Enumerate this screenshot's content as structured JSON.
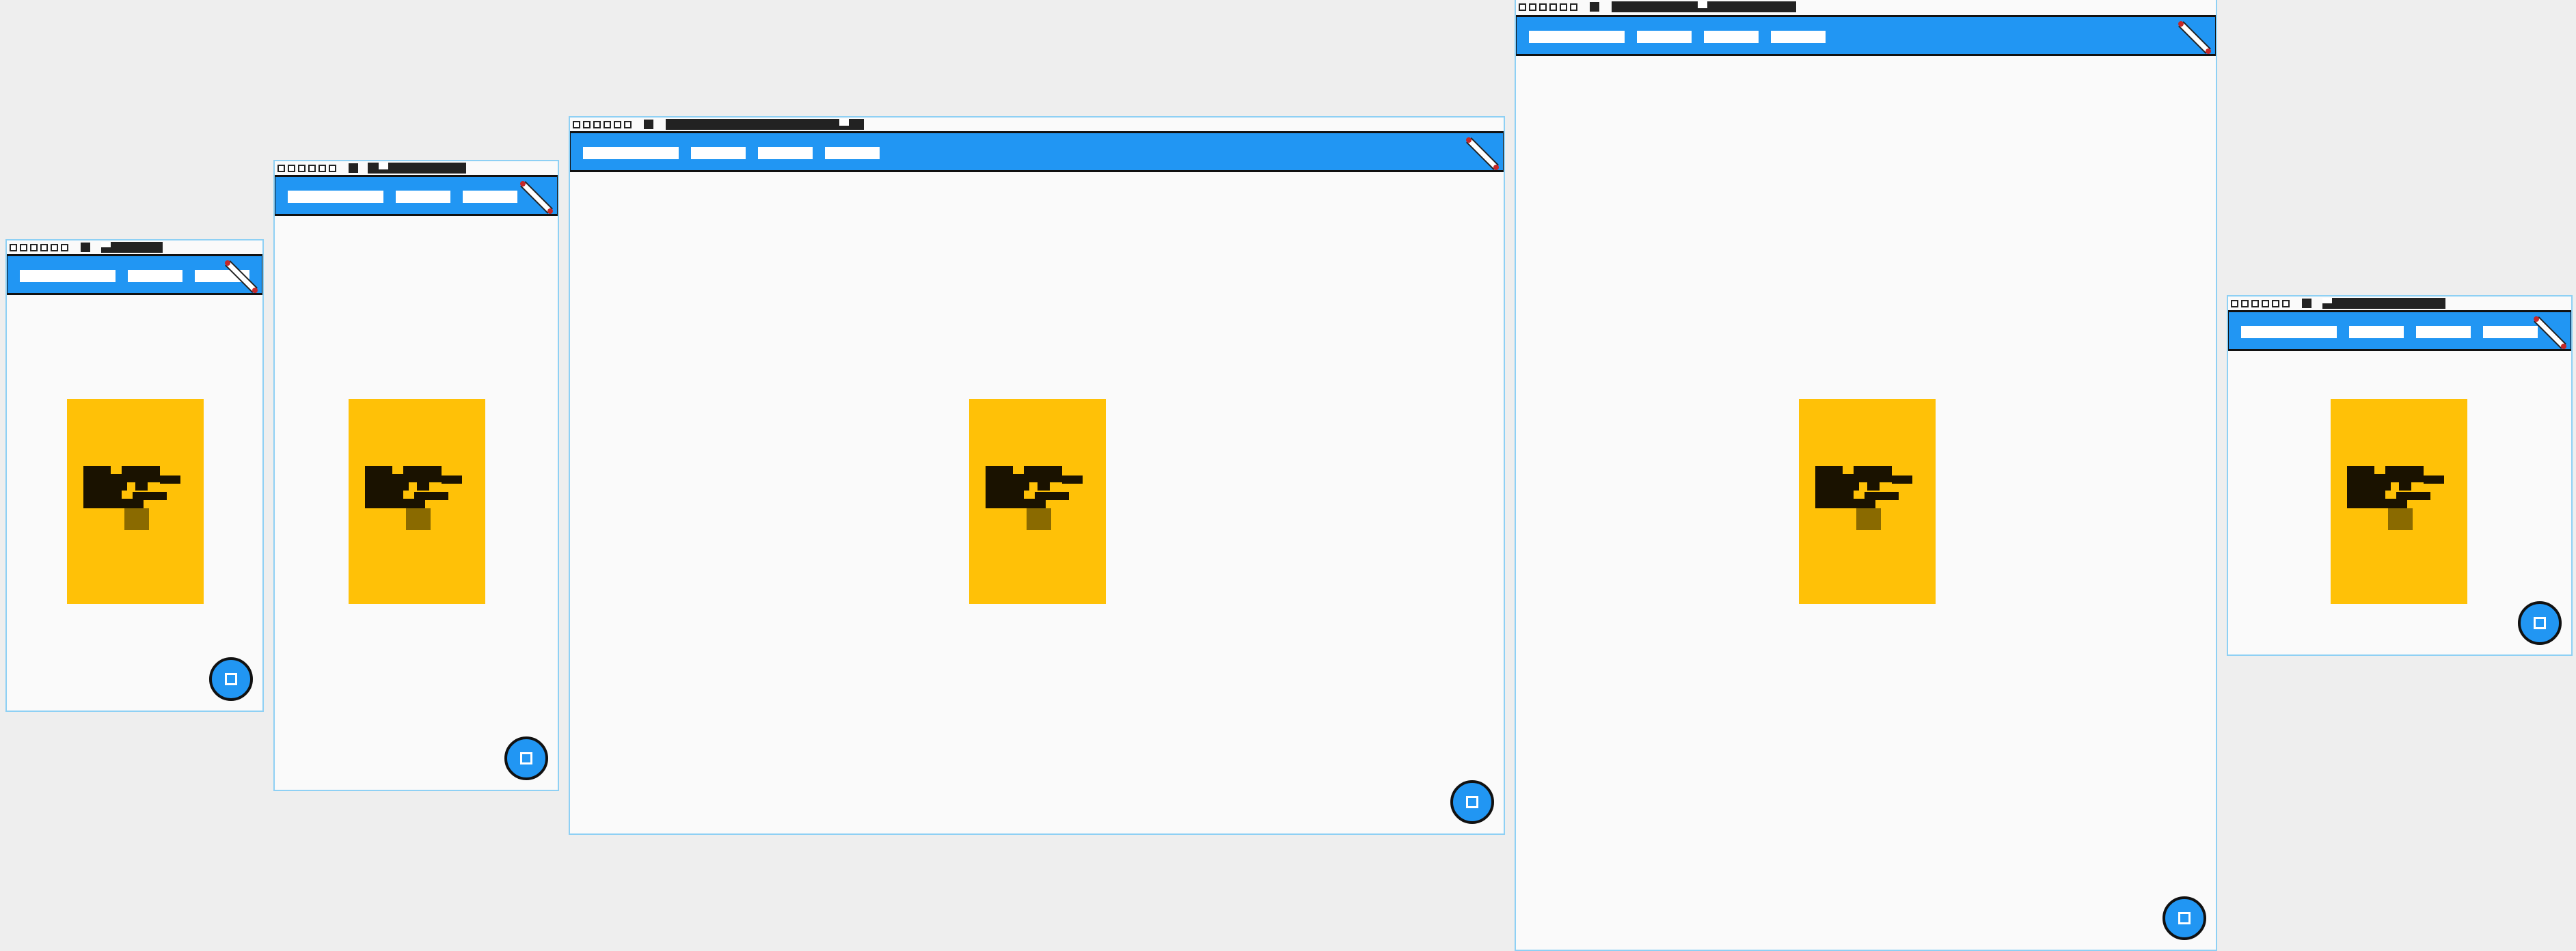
{
  "colors": {
    "background": "#eeeeee",
    "screen": "#fafafa",
    "screen_border": "#8ed0f4",
    "app_bar": "#2196f3",
    "card": "#ffc107",
    "card_figure": "#1a1200",
    "card_figure_base": "#8a6a00",
    "fab": "#2196f3"
  },
  "icons": {
    "app_bar_action": "pencil-icon",
    "fab": "square-icon",
    "card": "pixel-figure-icon"
  },
  "screens_count": 5
}
